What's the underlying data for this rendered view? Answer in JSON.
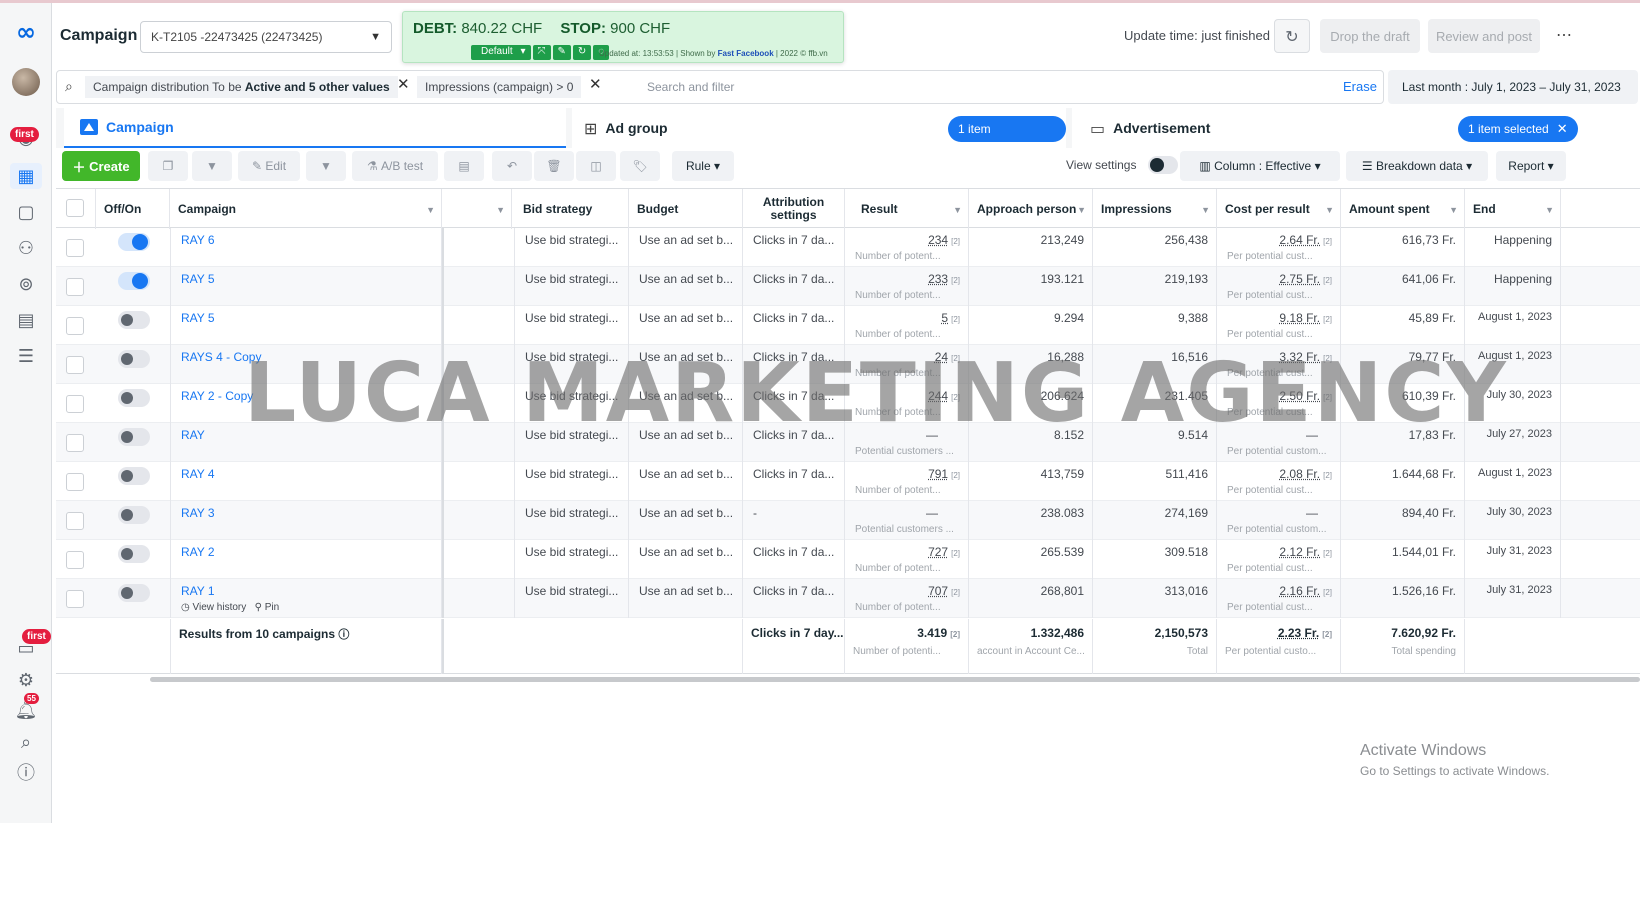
{
  "header": {
    "title": "Campaign",
    "account": "K-T2105 -22473425 (22473425)",
    "debt_label": "DEBT:",
    "debt_value": "840.22 CHF",
    "stop_label": "STOP:",
    "stop_value": "900 CHF",
    "default_btn": "Default",
    "updated_text": "Updated at: 13:53:53 | Shown by",
    "updated_brand": "Fast Facebook",
    "updated_suffix": "| 2022 © ffb.vn",
    "update_time": "Update time: just finished",
    "drop_draft": "Drop the draft",
    "review_post": "Review and post"
  },
  "filters": {
    "chip1_prefix": "Campaign distribution To be",
    "chip1_bold": "Active and 5 other values",
    "chip2": "Impressions (campaign) > 0",
    "placeholder": "Search and filter",
    "erase": "Erase",
    "date_range": "Last month : July 1, 2023 – July 31, 2023"
  },
  "tabs": {
    "campaign": "Campaign",
    "ad_group": "Ad group",
    "ad_group_selected": "1 item selected",
    "advertisement": "Advertisement",
    "advertisement_selected": "1 item selected"
  },
  "toolbar": {
    "create": "Create",
    "edit": "Edit",
    "ab_test": "A/B test",
    "rule": "Rule",
    "view_settings": "View settings",
    "columns": "Column : Effective",
    "breakdown": "Breakdown data",
    "report": "Report"
  },
  "columns": {
    "offon": "Off/On",
    "campaign": "Campaign",
    "bid": "Bid strategy",
    "budget": "Budget",
    "attribution": "Attribution settings",
    "result": "Result",
    "approach": "Approach person",
    "impressions": "Impressions",
    "cpr": "Cost per result",
    "spent": "Amount spent",
    "end": "End"
  },
  "rows": [
    {
      "on": true,
      "name": "RAY 6",
      "bid": "Use bid strategi...",
      "budget": "Use an ad set b...",
      "attr": "Clicks in 7 da...",
      "result": "234",
      "result_sub": "Number of potent...",
      "approach": "213,249",
      "impressions": "256,438",
      "cpr": "2.64 Fr.",
      "cpr_sub": "Per potential cust...",
      "spent": "616,73 Fr.",
      "end": "Happening"
    },
    {
      "on": true,
      "name": "RAY 5",
      "bid": "Use bid strategi...",
      "budget": "Use an ad set b...",
      "attr": "Clicks in 7 da...",
      "result": "233",
      "result_sub": "Number of potent...",
      "approach": "193.121",
      "impressions": "219,193",
      "cpr": "2.75 Fr.",
      "cpr_sub": "Per potential cust...",
      "spent": "641,06 Fr.",
      "end": "Happening"
    },
    {
      "on": false,
      "name": "RAY 5",
      "bid": "Use bid strategi...",
      "budget": "Use an ad set b...",
      "attr": "Clicks in 7 da...",
      "result": "5",
      "result_sub": "Number of potent...",
      "approach": "9.294",
      "impressions": "9,388",
      "cpr": "9.18 Fr.",
      "cpr_sub": "Per potential cust...",
      "spent": "45,89 Fr.",
      "end": "August 1, 2023"
    },
    {
      "on": false,
      "name": "RAYS 4 - Copy",
      "bid": "Use bid strategi...",
      "budget": "Use an ad set b...",
      "attr": "Clicks in 7 da...",
      "result": "24",
      "result_sub": "Number of potent...",
      "approach": "16,288",
      "impressions": "16,516",
      "cpr": "3.32 Fr.",
      "cpr_sub": "Per potential cust...",
      "spent": "79,77 Fr.",
      "end": "August 1, 2023"
    },
    {
      "on": false,
      "name": "RAY 2 - Copy",
      "bid": "Use bid strategi...",
      "budget": "Use an ad set b...",
      "attr": "Clicks in 7 da...",
      "result": "244",
      "result_sub": "Number of potent...",
      "approach": "206.624",
      "impressions": "231.405",
      "cpr": "2.50 Fr.",
      "cpr_sub": "Per potential cust...",
      "spent": "610,39 Fr.",
      "end": "July 30, 2023"
    },
    {
      "on": false,
      "name": "RAY",
      "bid": "Use bid strategi...",
      "budget": "Use an ad set b...",
      "attr": "Clicks in 7 da...",
      "result": "—",
      "result_sub": "Potential customers ...",
      "approach": "8.152",
      "impressions": "9.514",
      "cpr": "—",
      "cpr_sub": "Per potential custom...",
      "spent": "17,83 Fr.",
      "end": "July 27, 2023"
    },
    {
      "on": false,
      "name": "RAY 4",
      "bid": "Use bid strategi...",
      "budget": "Use an ad set b...",
      "attr": "Clicks in 7 da...",
      "result": "791",
      "result_sub": "Number of potent...",
      "approach": "413,759",
      "impressions": "511,416",
      "cpr": "2.08 Fr.",
      "cpr_sub": "Per potential cust...",
      "spent": "1.644,68 Fr.",
      "end": "August 1, 2023"
    },
    {
      "on": false,
      "name": "RAY 3",
      "bid": "Use bid strategi...",
      "budget": "Use an ad set b...",
      "attr": "-",
      "result": "—",
      "result_sub": "Potential customers ...",
      "approach": "238.083",
      "impressions": "274,169",
      "cpr": "—",
      "cpr_sub": "Per potential custom...",
      "spent": "894,40 Fr.",
      "end": "July 30, 2023"
    },
    {
      "on": false,
      "name": "RAY 2",
      "bid": "Use bid strategi...",
      "budget": "Use an ad set b...",
      "attr": "Clicks in 7 da...",
      "result": "727",
      "result_sub": "Number of potent...",
      "approach": "265.539",
      "impressions": "309.518",
      "cpr": "2.12 Fr.",
      "cpr_sub": "Per potential cust...",
      "spent": "1.544,01 Fr.",
      "end": "July 31, 2023"
    },
    {
      "on": false,
      "name": "RAY 1",
      "bid": "Use bid strategi...",
      "budget": "Use an ad set b...",
      "attr": "Clicks in 7 da...",
      "result": "707",
      "result_sub": "Number of potent...",
      "approach": "268,801",
      "impressions": "313,016",
      "cpr": "2.16 Fr.",
      "cpr_sub": "Per potential cust...",
      "spent": "1.526,16 Fr.",
      "end": "July 31, 2023",
      "view_history": "View history",
      "pin": "Pin"
    }
  ],
  "totals": {
    "label": "Results from 10 campaigns",
    "attr": "Clicks in 7 day...",
    "result": "3.419",
    "result_sub": "Number of potenti...",
    "approach": "1.332,486",
    "approach_sub": "account in Account Ce...",
    "impressions": "2,150,573",
    "impressions_sub": "Total",
    "cpr": "2.23 Fr.",
    "cpr_sub": "Per potential custo...",
    "spent": "7.620,92 Fr.",
    "spent_sub": "Total spending"
  },
  "sup_mark": "[2]",
  "rail": {
    "first_badge": "first",
    "notif_count": "55"
  },
  "watermark": "LUCA MARKETING AGENCY",
  "activate": {
    "title": "Activate Windows",
    "sub": "Go to Settings to activate Windows."
  }
}
